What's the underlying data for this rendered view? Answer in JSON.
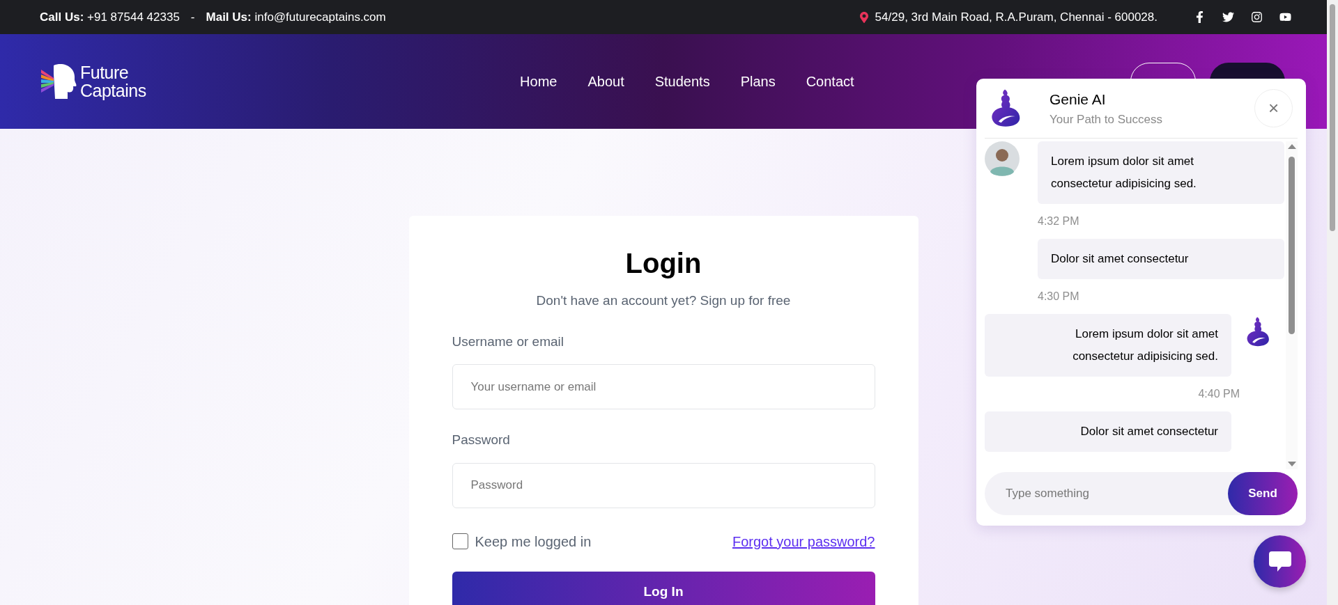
{
  "top_bar": {
    "call": "**Call Us:** +91 87544 42335",
    "separator": "-",
    "mail": "**Mail Us:** info@futurecaptains.com",
    "address": "54/29, 3rd Main Road, R.A.Puram, Chennai - 600028.",
    "social": [
      {
        "kind": "facebook"
      },
      {
        "kind": "twitter"
      },
      {
        "kind": "instagram"
      },
      {
        "kind": "youtube"
      }
    ]
  },
  "header": {
    "logo": [
      "Future",
      "Captains"
    ],
    "nav": [
      "Home",
      "About",
      "Students",
      "Plans",
      "Contact"
    ]
  },
  "login": {
    "title": "Login",
    "subtitle": "Don't have an account yet? Sign up for free",
    "fields": [
      {
        "label": "Username or email",
        "placeholder": "Your username or email"
      },
      {
        "label": "Password",
        "placeholder": "Password"
      }
    ],
    "remember": {
      "label": "Keep me logged in",
      "checked": false
    },
    "forgot": "Forgot your password?",
    "submit": "Log In"
  },
  "chat": {
    "title": "Genie AI",
    "subtitle": "Your Path to Success",
    "close": "×",
    "items": [
      {
        "kind": "user",
        "text": "Lorem ipsum dolor sit amet consectetur adipisicing sed.",
        "avatar": true,
        "time": "4:32 PM"
      },
      {
        "kind": "user",
        "text": "Dolor sit amet consectetur",
        "avatar": false,
        "time": "4:30 PM"
      },
      {
        "kind": "bot",
        "text": "Lorem ipsum dolor sit amet consectetur adipisicing sed.",
        "avatar": true,
        "time": "4:40 PM"
      },
      {
        "kind": "bot",
        "text": "Dolor sit amet consectetur",
        "avatar": false
      }
    ],
    "input": {
      "placeholder": "Type something"
    },
    "send": "Send"
  }
}
